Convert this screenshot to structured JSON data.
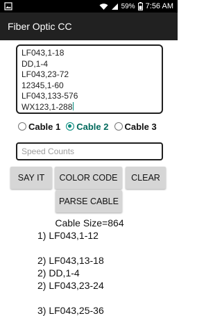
{
  "status_bar": {
    "battery_percent": "59%",
    "time": "7:56 AM"
  },
  "app": {
    "title": "Fiber Optic CC"
  },
  "input": {
    "lines": [
      "LF043,1-18",
      "DD,1-4",
      "LF043,23-72",
      "12345,1-60",
      "LF043,133-576",
      "WX123,1-288"
    ]
  },
  "radios": [
    {
      "label": "Cable 1",
      "checked": false
    },
    {
      "label": "Cable 2",
      "checked": true
    },
    {
      "label": "Cable 3",
      "checked": false
    }
  ],
  "speed": {
    "placeholder": "Speed Counts",
    "value": ""
  },
  "buttons": {
    "say_it": "SAY IT",
    "color_code": "COLOR CODE",
    "clear": "CLEAR",
    "parse_cable": "PARSE CABLE"
  },
  "results": {
    "cable_size": "Cable Size=864",
    "groups": [
      [
        "1) LF043,1-12"
      ],
      [
        "2) LF043,13-18",
        "2) DD,1-4",
        "2) LF043,23-24"
      ],
      [
        "3) LF043,25-36"
      ]
    ]
  }
}
